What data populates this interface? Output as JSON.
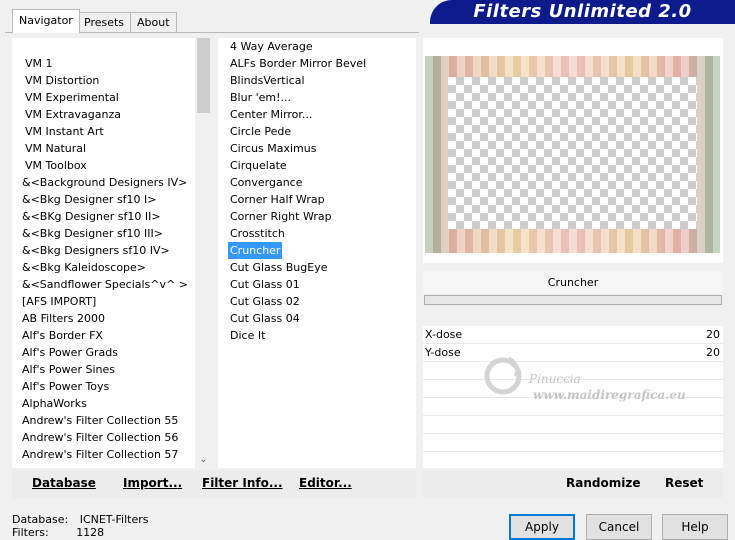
{
  "tabs": [
    "Navigator",
    "Presets",
    "About"
  ],
  "banner_title": "Filters Unlimited 2.0",
  "categories": [
    "VM 1",
    "VM Distortion",
    "VM Experimental",
    "VM Extravaganza",
    "VM Instant Art",
    "VM Natural",
    "VM Toolbox",
    "&<Background Designers IV>",
    "&<Bkg Designer sf10 I>",
    "&<BKg Designer sf10 II>",
    "&<Bkg Designer sf10 III>",
    "&<Bkg Designers sf10 IV>",
    "&<Bkg Kaleidoscope>",
    "&<Sandflower Specials^v^ >",
    "[AFS IMPORT]",
    "AB Filters 2000",
    "Alf's Border FX",
    "Alf's Power Grads",
    "Alf's Power Sines",
    "Alf's Power Toys",
    "AlphaWorks",
    "Andrew's Filter Collection 55",
    "Andrew's Filter Collection 56",
    "Andrew's Filter Collection 57"
  ],
  "filters": [
    "4 Way Average",
    "ALFs Border Mirror Bevel",
    "BlindsVertical",
    "Blur 'em!...",
    "Center Mirror...",
    "Circle Pede",
    "Circus Maximus",
    "Cirquelate",
    "Convergance",
    "Corner Half Wrap",
    "Corner Right Wrap",
    "Crosstitch",
    "Cruncher",
    "Cut Glass  BugEye",
    "Cut Glass 01",
    "Cut Glass 02",
    "Cut Glass 04",
    "Dice It"
  ],
  "selected_filter": "Cruncher",
  "params": [
    {
      "label": "X-dose",
      "value": "20"
    },
    {
      "label": "Y-dose",
      "value": "20"
    }
  ],
  "watermark": {
    "name": "Pinuccia",
    "url": "www.maidiregrafica.eu"
  },
  "buttons": {
    "database": "Database",
    "import": "Import...",
    "filter_info": "Filter Info...",
    "editor": "Editor...",
    "randomize": "Randomize",
    "reset": "Reset",
    "apply": "Apply",
    "cancel": "Cancel",
    "help": "Help"
  },
  "status": {
    "database_label": "Database:",
    "database_value": "ICNET-Filters",
    "filters_label": "Filters:",
    "filters_value": "1128"
  },
  "colors": {
    "banner": "#0d1a8c",
    "selection": "#3399ff",
    "default_button_border": "#0078d7"
  }
}
